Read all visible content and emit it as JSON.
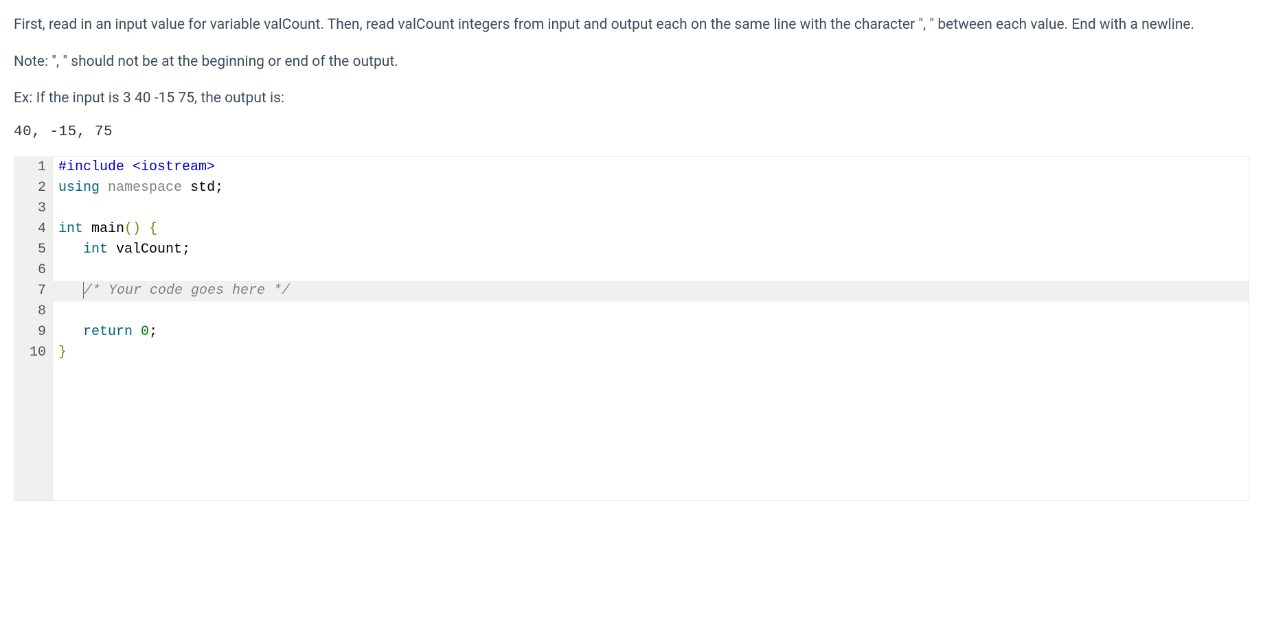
{
  "problem": {
    "paragraph1": "First, read in an input value for variable valCount. Then, read valCount integers from input and output each on the same line with the character \", \" between each value. End with a newline.",
    "paragraph2": "Note: \", \" should not be at the beginning or end of the output.",
    "paragraph3": "Ex: If the input is 3 40 -15 75, the output is:",
    "example_output": "40, -15, 75"
  },
  "code": {
    "lines": [
      {
        "num": "1",
        "tokens": [
          {
            "cls": "tok-preproc",
            "text": "#include"
          },
          {
            "cls": "tok-punct",
            "text": " "
          },
          {
            "cls": "tok-preproc",
            "text": "<iostream>"
          }
        ]
      },
      {
        "num": "2",
        "tokens": [
          {
            "cls": "tok-keyword",
            "text": "using"
          },
          {
            "cls": "",
            "text": " "
          },
          {
            "cls": "tok-namespace",
            "text": "namespace"
          },
          {
            "cls": "",
            "text": " "
          },
          {
            "cls": "tok-ident",
            "text": "std"
          },
          {
            "cls": "tok-punct",
            "text": ";"
          }
        ]
      },
      {
        "num": "3",
        "tokens": []
      },
      {
        "num": "4",
        "tokens": [
          {
            "cls": "tok-type",
            "text": "int"
          },
          {
            "cls": "",
            "text": " "
          },
          {
            "cls": "tok-func",
            "text": "main"
          },
          {
            "cls": "tok-paren",
            "text": "()"
          },
          {
            "cls": "",
            "text": " "
          },
          {
            "cls": "tok-brace",
            "text": "{"
          }
        ]
      },
      {
        "num": "5",
        "tokens": [
          {
            "cls": "",
            "text": "   "
          },
          {
            "cls": "tok-type",
            "text": "int"
          },
          {
            "cls": "",
            "text": " "
          },
          {
            "cls": "tok-ident",
            "text": "valCount"
          },
          {
            "cls": "tok-punct",
            "text": ";"
          }
        ]
      },
      {
        "num": "6",
        "tokens": []
      },
      {
        "num": "7",
        "highlighted": true,
        "cursor": true,
        "tokens": [
          {
            "cls": "",
            "text": "   "
          },
          {
            "cls": "tok-comment",
            "text": "/* Your code goes here */"
          }
        ]
      },
      {
        "num": "8",
        "tokens": []
      },
      {
        "num": "9",
        "tokens": [
          {
            "cls": "",
            "text": "   "
          },
          {
            "cls": "tok-keyword",
            "text": "return"
          },
          {
            "cls": "",
            "text": " "
          },
          {
            "cls": "tok-number",
            "text": "0"
          },
          {
            "cls": "tok-punct",
            "text": ";"
          }
        ]
      },
      {
        "num": "10",
        "tokens": [
          {
            "cls": "tok-brace",
            "text": "}"
          }
        ]
      }
    ]
  }
}
